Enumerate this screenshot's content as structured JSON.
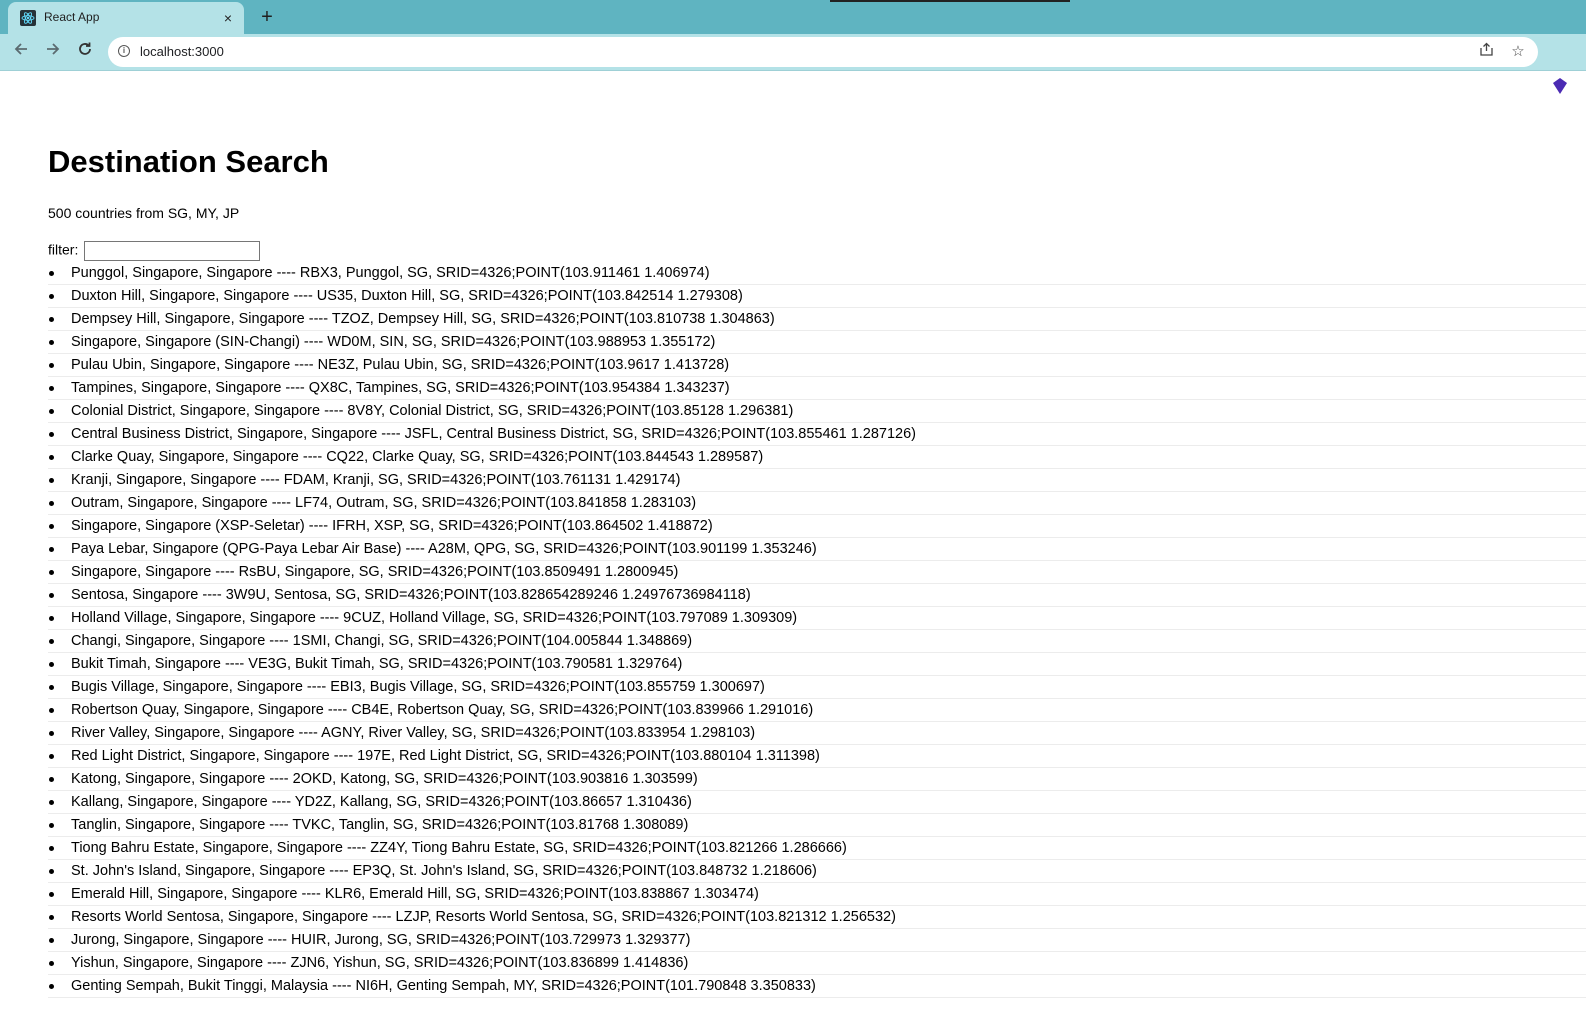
{
  "browser": {
    "tab_title": "React App",
    "new_tab_label": "+",
    "close_label": "×",
    "url": "localhost:3000"
  },
  "page": {
    "title": "Destination Search",
    "subtitle": "500 countries from SG, MY, JP",
    "filter_label": "filter:",
    "filter_value": ""
  },
  "results": [
    "Punggol, Singapore, Singapore ---- RBX3, Punggol, SG, SRID=4326;POINT(103.911461 1.406974)",
    "Duxton Hill, Singapore, Singapore ---- US35, Duxton Hill, SG, SRID=4326;POINT(103.842514 1.279308)",
    "Dempsey Hill, Singapore, Singapore ---- TZOZ, Dempsey Hill, SG, SRID=4326;POINT(103.810738 1.304863)",
    "Singapore, Singapore (SIN-Changi) ---- WD0M, SIN, SG, SRID=4326;POINT(103.988953 1.355172)",
    "Pulau Ubin, Singapore, Singapore ---- NE3Z, Pulau Ubin, SG, SRID=4326;POINT(103.9617 1.413728)",
    "Tampines, Singapore, Singapore ---- QX8C, Tampines, SG, SRID=4326;POINT(103.954384 1.343237)",
    "Colonial District, Singapore, Singapore ---- 8V8Y, Colonial District, SG, SRID=4326;POINT(103.85128 1.296381)",
    "Central Business District, Singapore, Singapore ---- JSFL, Central Business District, SG, SRID=4326;POINT(103.855461 1.287126)",
    "Clarke Quay, Singapore, Singapore ---- CQ22, Clarke Quay, SG, SRID=4326;POINT(103.844543 1.289587)",
    "Kranji, Singapore, Singapore ---- FDAM, Kranji, SG, SRID=4326;POINT(103.761131 1.429174)",
    "Outram, Singapore, Singapore ---- LF74, Outram, SG, SRID=4326;POINT(103.841858 1.283103)",
    "Singapore, Singapore (XSP-Seletar) ---- IFRH, XSP, SG, SRID=4326;POINT(103.864502 1.418872)",
    "Paya Lebar, Singapore (QPG-Paya Lebar Air Base) ---- A28M, QPG, SG, SRID=4326;POINT(103.901199 1.353246)",
    "Singapore, Singapore ---- RsBU, Singapore, SG, SRID=4326;POINT(103.8509491 1.2800945)",
    "Sentosa, Singapore ---- 3W9U, Sentosa, SG, SRID=4326;POINT(103.828654289246 1.24976736984118)",
    "Holland Village, Singapore, Singapore ---- 9CUZ, Holland Village, SG, SRID=4326;POINT(103.797089 1.309309)",
    "Changi, Singapore, Singapore ---- 1SMI, Changi, SG, SRID=4326;POINT(104.005844 1.348869)",
    "Bukit Timah, Singapore ---- VE3G, Bukit Timah, SG, SRID=4326;POINT(103.790581 1.329764)",
    "Bugis Village, Singapore, Singapore ---- EBI3, Bugis Village, SG, SRID=4326;POINT(103.855759 1.300697)",
    "Robertson Quay, Singapore, Singapore ---- CB4E, Robertson Quay, SG, SRID=4326;POINT(103.839966 1.291016)",
    "River Valley, Singapore, Singapore ---- AGNY, River Valley, SG, SRID=4326;POINT(103.833954 1.298103)",
    "Red Light District, Singapore, Singapore ---- 197E, Red Light District, SG, SRID=4326;POINT(103.880104 1.311398)",
    "Katong, Singapore, Singapore ---- 2OKD, Katong, SG, SRID=4326;POINT(103.903816 1.303599)",
    "Kallang, Singapore, Singapore ---- YD2Z, Kallang, SG, SRID=4326;POINT(103.86657 1.310436)",
    "Tanglin, Singapore, Singapore ---- TVKC, Tanglin, SG, SRID=4326;POINT(103.81768 1.308089)",
    "Tiong Bahru Estate, Singapore, Singapore ---- ZZ4Y, Tiong Bahru Estate, SG, SRID=4326;POINT(103.821266 1.286666)",
    "St. John's Island, Singapore, Singapore ---- EP3Q, St. John's Island, SG, SRID=4326;POINT(103.848732 1.218606)",
    "Emerald Hill, Singapore, Singapore ---- KLR6, Emerald Hill, SG, SRID=4326;POINT(103.838867 1.303474)",
    "Resorts World Sentosa, Singapore, Singapore ---- LZJP, Resorts World Sentosa, SG, SRID=4326;POINT(103.821312 1.256532)",
    "Jurong, Singapore, Singapore ---- HUIR, Jurong, SG, SRID=4326;POINT(103.729973 1.329377)",
    "Yishun, Singapore, Singapore ---- ZJN6, Yishun, SG, SRID=4326;POINT(103.836899 1.414836)",
    "Genting Sempah, Bukit Tinggi, Malaysia ---- NI6H, Genting Sempah, MY, SRID=4326;POINT(101.790848 3.350833)"
  ]
}
